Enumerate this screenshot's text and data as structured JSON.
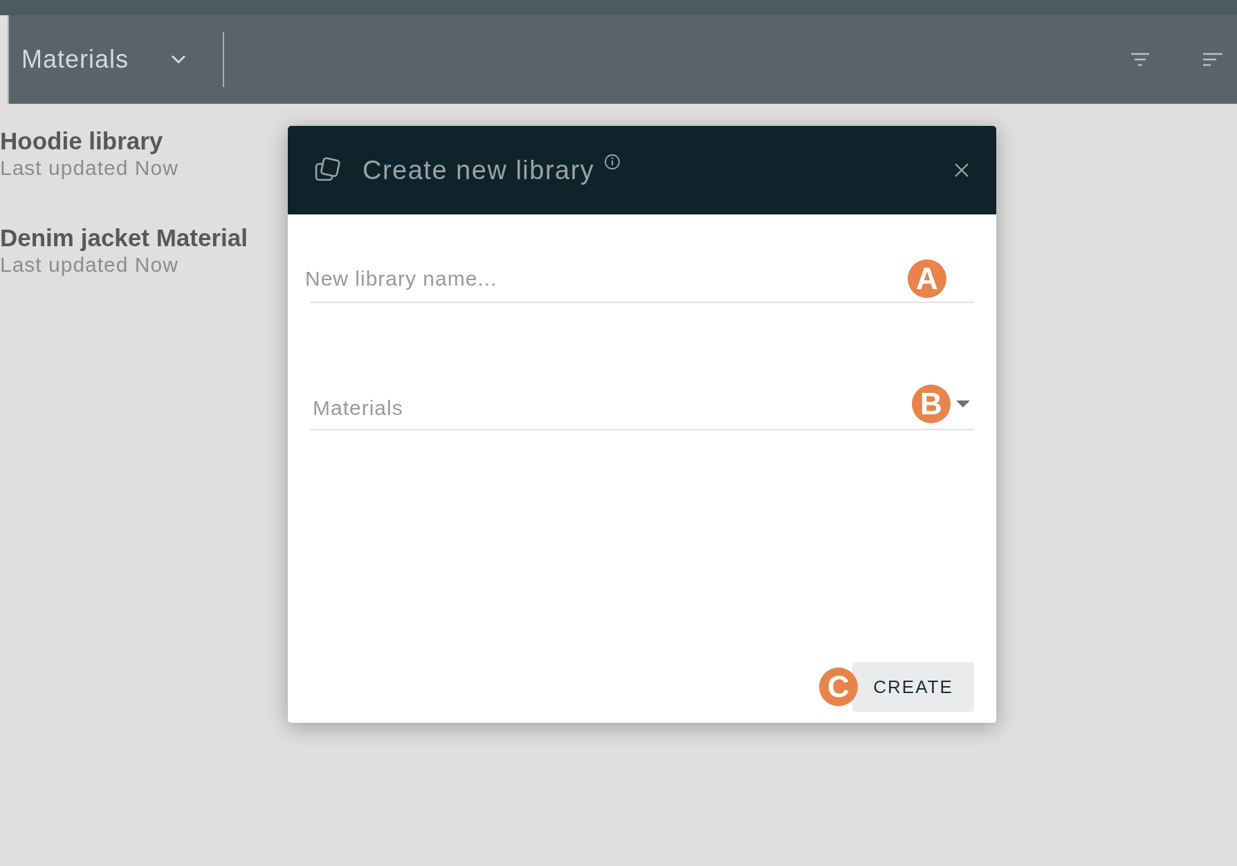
{
  "top_bar": {
    "dropdown": {
      "label": "Materials"
    }
  },
  "libraries": [
    {
      "name": "Hoodie library",
      "updated": "Last updated Now"
    },
    {
      "name": "Denim jacket Material",
      "updated": "Last updated Now"
    }
  ],
  "dialog": {
    "title": "Create new library",
    "name_field": {
      "placeholder": "New library name...",
      "badge": "A"
    },
    "type_select": {
      "label": "Materials",
      "badge": "B"
    },
    "create_button": {
      "label": "CREATE",
      "badge": "C"
    }
  }
}
